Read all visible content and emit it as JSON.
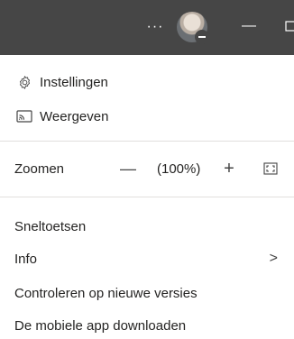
{
  "titlebar": {
    "more_glyph": "···",
    "minimize_glyph": "—"
  },
  "menu": {
    "settings": "Instellingen",
    "display": "Weergeven",
    "zoom": {
      "label": "Zoomen",
      "out_glyph": "—",
      "value": "(100%)",
      "in_glyph": "+"
    },
    "shortcuts": "Sneltoetsen",
    "info": "Info",
    "info_chevron": ">",
    "check_updates": "Controleren op nieuwe versies",
    "mobile_app": "De mobiele app downloaden"
  },
  "icons": {
    "settings": "gear-icon",
    "display": "cast-icon",
    "fullscreen": "fullscreen-icon"
  }
}
